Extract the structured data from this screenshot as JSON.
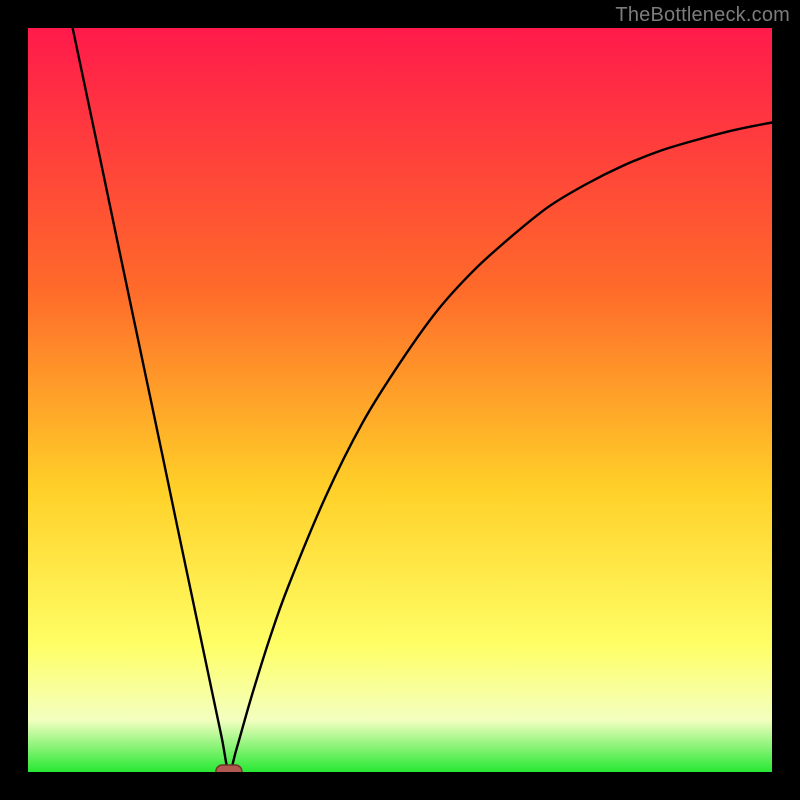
{
  "watermark": "TheBottleneck.com",
  "colors": {
    "frame": "#000000",
    "gradient_top": "#ff1a4b",
    "gradient_mid1": "#ff6a2a",
    "gradient_mid2": "#ffd028",
    "gradient_low": "#ffff66",
    "gradient_pale": "#f3ffc0",
    "gradient_green": "#27e833",
    "curve": "#000000",
    "marker_fill": "#b1594f",
    "marker_stroke": "#6f332c"
  },
  "chart_data": {
    "type": "line",
    "title": "",
    "xlabel": "",
    "ylabel": "",
    "xlim": [
      0,
      100
    ],
    "ylim": [
      0,
      100
    ],
    "grid": false,
    "legend": false,
    "optimum_x": 27,
    "marker": {
      "x": 27,
      "y": 0
    },
    "curve_points": [
      {
        "x": 6.0,
        "y": 100.0
      },
      {
        "x": 8.0,
        "y": 90.5
      },
      {
        "x": 10.0,
        "y": 81.0
      },
      {
        "x": 12.0,
        "y": 71.4
      },
      {
        "x": 14.0,
        "y": 61.9
      },
      {
        "x": 16.0,
        "y": 52.4
      },
      {
        "x": 18.0,
        "y": 42.9
      },
      {
        "x": 20.0,
        "y": 33.3
      },
      {
        "x": 22.0,
        "y": 23.8
      },
      {
        "x": 24.0,
        "y": 14.3
      },
      {
        "x": 26.0,
        "y": 4.8
      },
      {
        "x": 27.0,
        "y": 0.0
      },
      {
        "x": 28.0,
        "y": 3.0
      },
      {
        "x": 30.0,
        "y": 10.0
      },
      {
        "x": 32.5,
        "y": 18.0
      },
      {
        "x": 35.0,
        "y": 25.0
      },
      {
        "x": 40.0,
        "y": 37.0
      },
      {
        "x": 45.0,
        "y": 47.0
      },
      {
        "x": 50.0,
        "y": 55.0
      },
      {
        "x": 55.0,
        "y": 62.0
      },
      {
        "x": 60.0,
        "y": 67.5
      },
      {
        "x": 65.0,
        "y": 72.0
      },
      {
        "x": 70.0,
        "y": 76.0
      },
      {
        "x": 75.0,
        "y": 79.0
      },
      {
        "x": 80.0,
        "y": 81.5
      },
      {
        "x": 85.0,
        "y": 83.5
      },
      {
        "x": 90.0,
        "y": 85.0
      },
      {
        "x": 95.0,
        "y": 86.3
      },
      {
        "x": 100.0,
        "y": 87.3
      }
    ]
  }
}
